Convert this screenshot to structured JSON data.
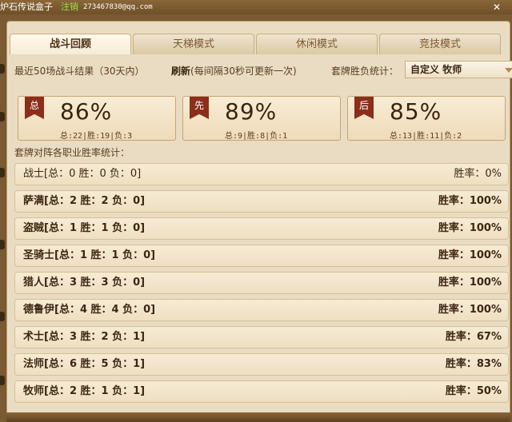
{
  "titlebar": {
    "title": "炉石传说盒子",
    "logout": "注销",
    "email": "273467830@qq.com",
    "close": "✕"
  },
  "tabs": [
    {
      "label": "战斗回顾",
      "active": true
    },
    {
      "label": "天梯模式",
      "active": false
    },
    {
      "label": "休闲模式",
      "active": false
    },
    {
      "label": "竞技模式",
      "active": false
    }
  ],
  "filter": {
    "recent": "最近50场战斗结果（30天内）",
    "refresh": "刷新",
    "refresh_note": "(每间隔30秒可更新一次)",
    "deck_label": "套牌胜负统计：",
    "deck_value": "自定义 牧师"
  },
  "stats": [
    {
      "badge": "总",
      "percent": "86%",
      "detail": "总:22|胜:19|负:3"
    },
    {
      "badge": "先",
      "percent": "89%",
      "detail": "总:9|胜:8|负:1"
    },
    {
      "badge": "后",
      "percent": "85%",
      "detail": "总:13|胜:11|负:2"
    }
  ],
  "section_label": "套牌对阵各职业胜率统计：",
  "classes": [
    {
      "name": "战士[总：0 胜：0 负：0]",
      "rate": "胜率：0%"
    },
    {
      "name": "萨满[总：2 胜：2 负：0]",
      "rate": "胜率：100%"
    },
    {
      "name": "盗贼[总：1 胜：1 负：0]",
      "rate": "胜率：100%"
    },
    {
      "name": "圣骑士[总：1 胜：1 负：0]",
      "rate": "胜率：100%"
    },
    {
      "name": "猎人[总：3 胜：3 负：0]",
      "rate": "胜率：100%"
    },
    {
      "name": "德鲁伊[总：4 胜：4 负：0]",
      "rate": "胜率：100%"
    },
    {
      "name": "术士[总：3 胜：2 负：1]",
      "rate": "胜率：67%"
    },
    {
      "name": "法师[总：6 胜：5 负：1]",
      "rate": "胜率：83%"
    },
    {
      "name": "牧师[总：2 胜：1 负：1]",
      "rate": "胜率：50%"
    }
  ]
}
